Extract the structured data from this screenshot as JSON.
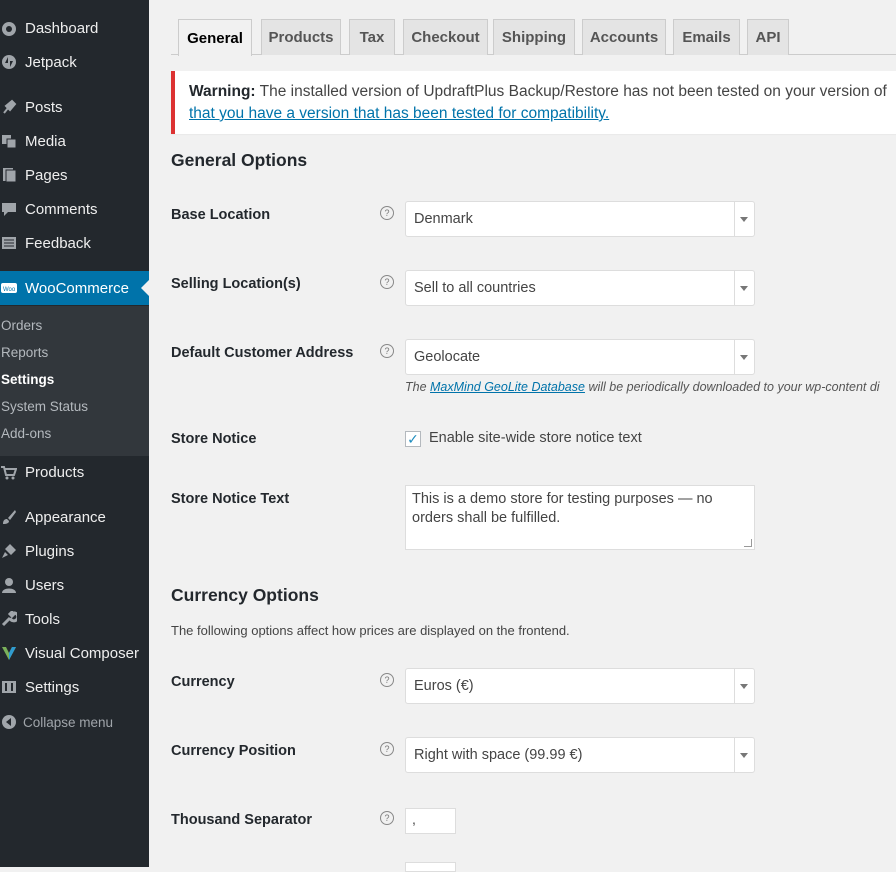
{
  "sidebar": {
    "items": [
      {
        "label": "Dashboard",
        "icon": "dashboard-icon"
      },
      {
        "label": "Jetpack",
        "icon": "jetpack-icon"
      },
      {
        "label": "Posts",
        "icon": "pin-icon"
      },
      {
        "label": "Media",
        "icon": "media-icon"
      },
      {
        "label": "Pages",
        "icon": "page-icon"
      },
      {
        "label": "Comments",
        "icon": "comment-icon"
      },
      {
        "label": "Feedback",
        "icon": "feedback-icon"
      },
      {
        "label": "WooCommerce",
        "icon": "woo-icon"
      },
      {
        "label": "Products",
        "icon": "cart-icon"
      },
      {
        "label": "Appearance",
        "icon": "brush-icon"
      },
      {
        "label": "Plugins",
        "icon": "plugin-icon"
      },
      {
        "label": "Users",
        "icon": "user-icon"
      },
      {
        "label": "Tools",
        "icon": "wrench-icon"
      },
      {
        "label": "Visual Composer",
        "icon": "vc-icon"
      },
      {
        "label": "Settings",
        "icon": "settings-icon"
      },
      {
        "label": "Collapse menu",
        "icon": "collapse-icon"
      }
    ],
    "submenu": [
      "Orders",
      "Reports",
      "Settings",
      "System Status",
      "Add-ons"
    ],
    "active_color": "#0073aa"
  },
  "tabs": [
    "General",
    "Products",
    "Tax",
    "Checkout",
    "Shipping",
    "Accounts",
    "Emails",
    "API"
  ],
  "notice": {
    "strong": "Warning:",
    "text": " The installed version of UpdraftPlus Backup/Restore has not been tested on your version of",
    "link": "that you have a version that has been tested for compatibility."
  },
  "general": {
    "heading": "General Options",
    "base_location": {
      "label": "Base Location",
      "value": "Denmark"
    },
    "selling": {
      "label": "Selling Location(s)",
      "value": "Sell to all countries"
    },
    "default_address": {
      "label": "Default Customer Address",
      "value": "Geolocate"
    },
    "desc_pre": "The ",
    "desc_link": "MaxMind GeoLite Database",
    "desc_post": " will be periodically downloaded to your wp-content di",
    "store_notice": {
      "label": "Store Notice",
      "checkbox_label": "Enable site-wide store notice text",
      "checked": true
    },
    "store_notice_text": {
      "label": "Store Notice Text",
      "value": "This is a demo store for testing purposes — no orders shall be fulfilled."
    }
  },
  "currency": {
    "heading": "Currency Options",
    "intro": "The following options affect how prices are displayed on the frontend.",
    "currency": {
      "label": "Currency",
      "value": "Euros (€)"
    },
    "position": {
      "label": "Currency Position",
      "value": "Right with space (99.99 €)"
    },
    "thousand": {
      "label": "Thousand Separator",
      "value": ","
    }
  }
}
